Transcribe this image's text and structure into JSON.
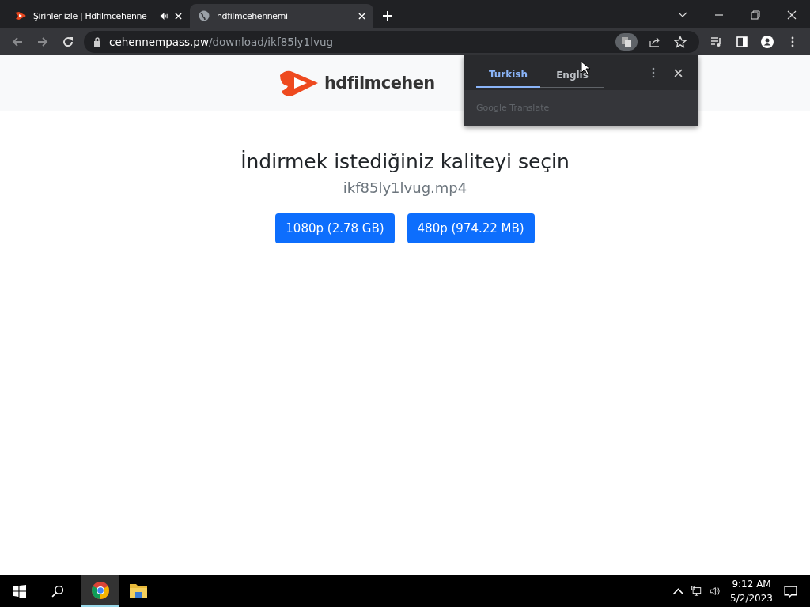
{
  "tabs": [
    {
      "title": "Şirinler izle | Hdfilmcehenne",
      "audio": true,
      "selected": false
    },
    {
      "title": "hdfilmcehennemi",
      "audio": false,
      "selected": true
    }
  ],
  "address": {
    "host": "cehennempass.pw",
    "path": "/download/ikf85ly1lvug"
  },
  "page": {
    "logo": "hdfilmcehen",
    "heading": "İndirmek istediğiniz kaliteyi seçin",
    "filename": "ikf85ly1lvug.mp4",
    "buttons": [
      "1080p (2.78 GB)",
      "480p (974.22 MB)"
    ]
  },
  "translate": {
    "tabs": [
      {
        "label": "Turkish",
        "selected": true
      },
      {
        "label": "Englis",
        "selected": false
      }
    ],
    "footer": "Google Translate"
  },
  "taskbar": {
    "apps": [
      {
        "kind": "chrome",
        "selected": true
      },
      {
        "kind": "folder",
        "selected": false
      }
    ],
    "time": "9:12 AM",
    "date": "5/2/2023"
  }
}
